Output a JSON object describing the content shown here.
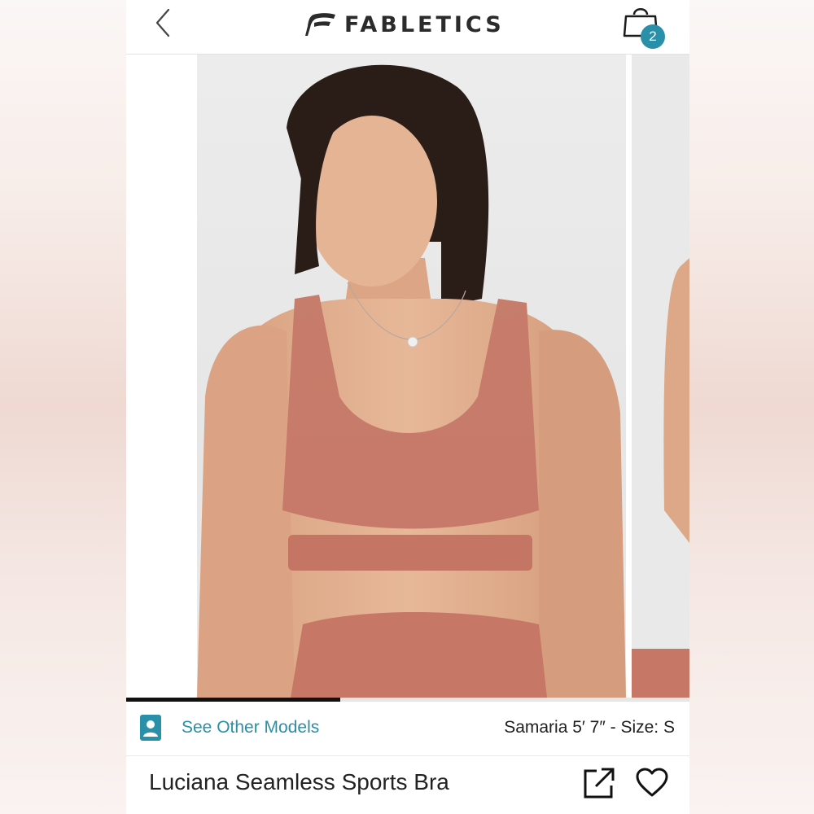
{
  "header": {
    "brand": "FABLETICS",
    "bag_count": "2",
    "back_icon": "chevron-left-icon",
    "bag_icon": "shopping-bag-icon"
  },
  "carousel": {
    "current_slide": 1,
    "slide_progress": 0.38
  },
  "models": {
    "link_label": "See Other Models",
    "model_info": "Samaria 5′ 7″ - Size: S",
    "icon": "person-badge-icon"
  },
  "product": {
    "title": "Luciana Seamless Sports Bra",
    "share_icon": "share-external-icon",
    "favorite_icon": "heart-icon"
  },
  "colors": {
    "accent": "#2a8fa8",
    "product_color": "#c9826f",
    "text": "#222222"
  }
}
